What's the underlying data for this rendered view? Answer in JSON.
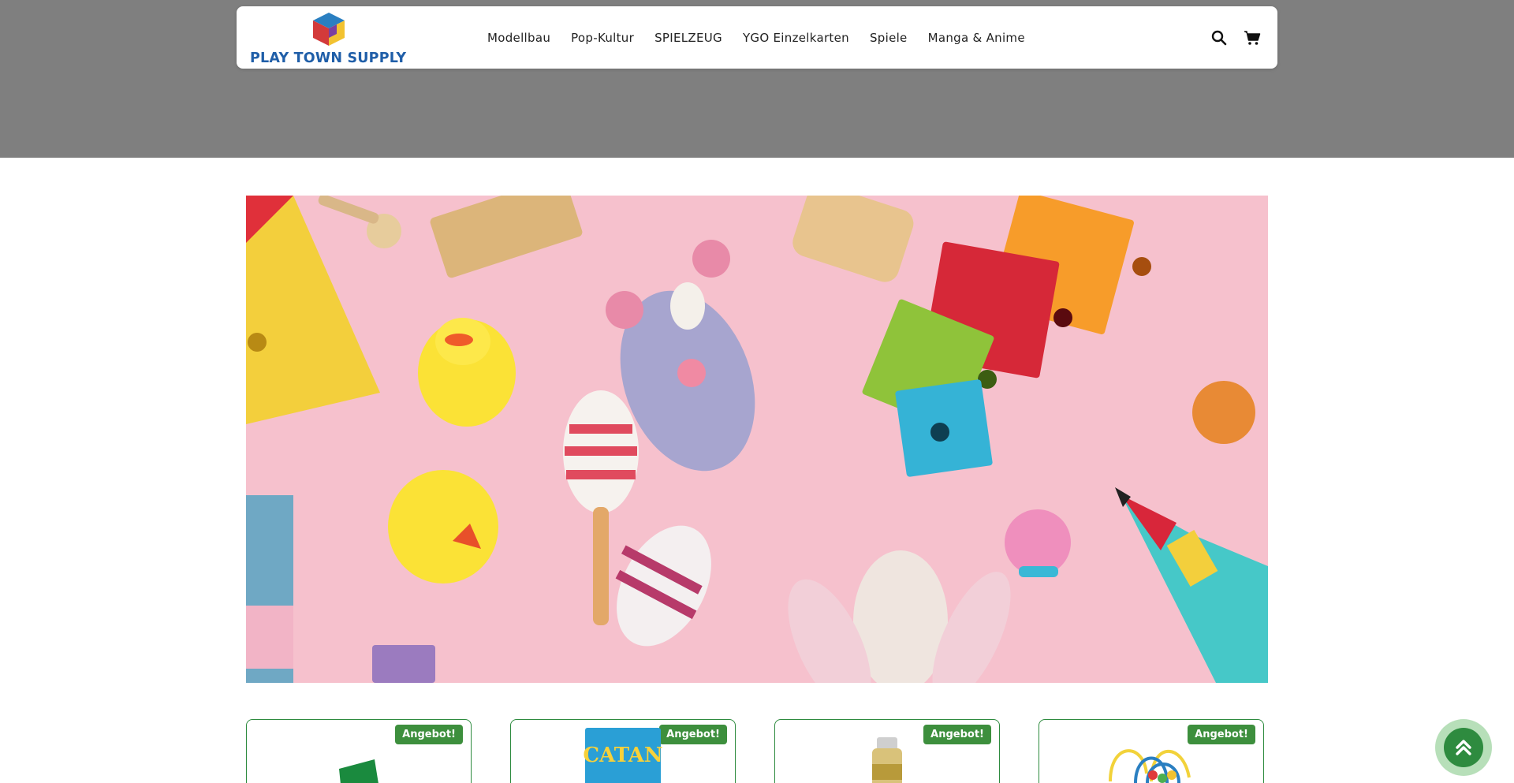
{
  "brand": {
    "name": "PLAY TOWN SUPPLY",
    "text_color": "#1f5ea8"
  },
  "nav": {
    "items": [
      {
        "label": "Modellbau"
      },
      {
        "label": "Pop-Kultur"
      },
      {
        "label": "SPIELZEUG"
      },
      {
        "label": "YGO Einzelkarten"
      },
      {
        "label": "Spiele"
      },
      {
        "label": "Manga & Anime"
      }
    ]
  },
  "header_icons": {
    "search": "search-icon",
    "cart": "cart-icon"
  },
  "hero": {
    "subject": "toys-on-pink-background",
    "bg_color": "#f7c3cf"
  },
  "products": [
    {
      "badge": "Angebot!",
      "thumb_text": ""
    },
    {
      "badge": "Angebot!",
      "thumb_text": "CATAN"
    },
    {
      "badge": "Angebot!",
      "thumb_text": ""
    },
    {
      "badge": "Angebot!",
      "thumb_text": ""
    }
  ],
  "colors": {
    "accent": "#2e8b3f",
    "band": "#7f7f7f"
  },
  "scroll_top": {
    "icon": "chevron-double-up-icon"
  }
}
